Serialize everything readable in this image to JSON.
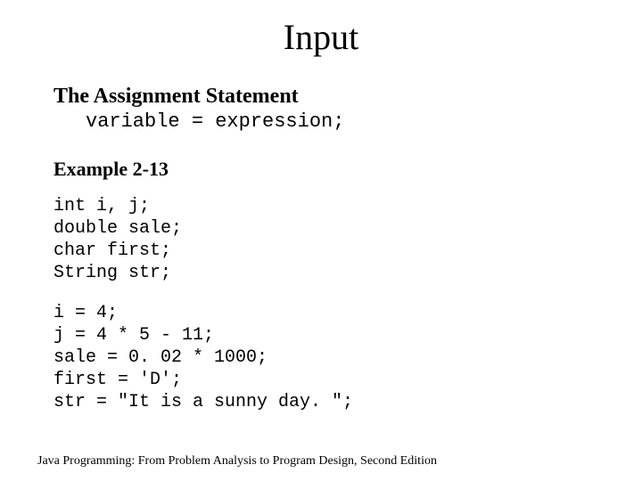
{
  "title": "Input",
  "heading": "The Assignment Statement",
  "syntax": "variable = expression;",
  "subheading": "Example 2-13",
  "code1": "int i, j;\ndouble sale;\nchar first;\nString str;",
  "code2": "i = 4;\nj = 4 * 5 - 11;\nsale = 0. 02 * 1000;\nfirst = 'D';\nstr = \"It is a sunny day. \";",
  "footer": "Java Programming: From Problem Analysis to Program Design, Second Edition"
}
